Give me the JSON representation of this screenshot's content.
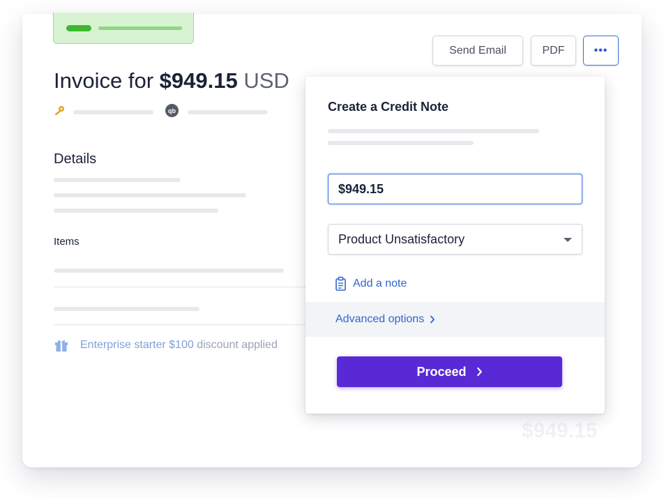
{
  "toolbar": {
    "send_email_label": "Send Email",
    "pdf_label": "PDF",
    "more_label": "•••"
  },
  "invoice": {
    "title_prefix": "Invoice for",
    "amount": "$949.15",
    "currency": "USD"
  },
  "details": {
    "heading": "Details",
    "items_label": "Items"
  },
  "discount": {
    "highlight": "Enterprise starter $100",
    "rest": " discount applied"
  },
  "footer": {
    "total_ghost": "$949.15"
  },
  "icons": {
    "quickbooks_glyph": "qb"
  },
  "credit_note": {
    "title": "Create a Credit Note",
    "amount_value": "$949.15",
    "reason_value": "Product Unsatisfactory",
    "reason_options": [
      "Product Unsatisfactory"
    ],
    "add_note_label": "Add a note",
    "advanced_label": "Advanced options",
    "proceed_label": "Proceed"
  },
  "colors": {
    "accent": "#3d70d6",
    "link": "#2f66d0",
    "primary_button": "#5929d6",
    "status_green": "#3fb82e"
  }
}
